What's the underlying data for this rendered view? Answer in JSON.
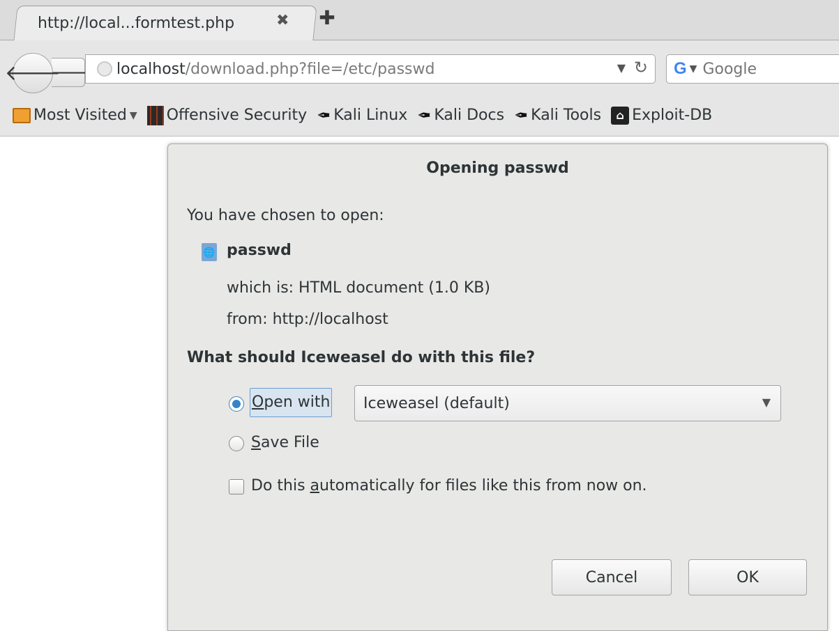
{
  "browser": {
    "tab": {
      "title": "http://local...formtest.php",
      "close_glyph": "✖"
    },
    "new_tab_glyph": "✚",
    "nav": {
      "back_glyph": "🡐",
      "forward_glyph": "🡒",
      "url_host": "localhost",
      "url_path": "/download.php?file=/etc/passwd",
      "url_dropmarker": "▼",
      "reload_glyph": "C",
      "search_engine_glyph": "G",
      "search_engine_drop": "▼",
      "search_placeholder": "Google"
    },
    "bookmarks": [
      {
        "label": "Most Visited",
        "icon": "folder-icon",
        "dropdown": "▼"
      },
      {
        "label": "Offensive Security",
        "icon": "offsec-icon"
      },
      {
        "label": "Kali Linux",
        "icon": "kali-dragon-icon"
      },
      {
        "label": "Kali Docs",
        "icon": "kali-dragon-icon"
      },
      {
        "label": "Kali Tools",
        "icon": "kali-dragon-icon"
      },
      {
        "label": "Exploit-DB",
        "icon": "exploit-db-icon"
      }
    ]
  },
  "dialog": {
    "title": "Opening passwd",
    "chosen_label": "You have chosen to open:",
    "file_name": "passwd",
    "file_type": "which is: HTML document (1.0 KB)",
    "file_from": "from: http://localhost",
    "question": "What should Iceweasel do with this file?",
    "open_with": {
      "access_key": "O",
      "rest": "pen with",
      "checked": true
    },
    "app_select_value": "Iceweasel (default)",
    "app_select_arrow": "▼",
    "save_file": {
      "access_key": "S",
      "rest": "ave File",
      "checked": false
    },
    "auto": {
      "before": "Do this ",
      "access_key": "a",
      "after": "utomatically for files like this from now on.",
      "checked": false
    },
    "cancel_label": "Cancel",
    "ok_label": "OK"
  }
}
